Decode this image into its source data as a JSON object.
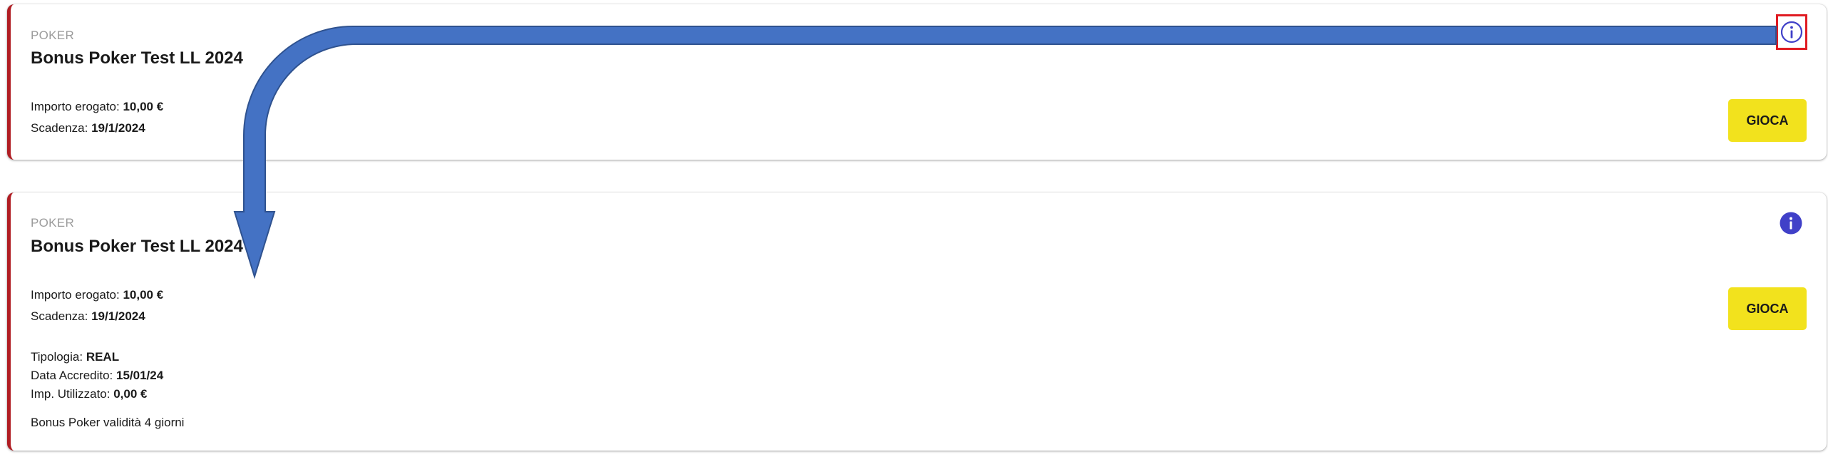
{
  "cards": [
    {
      "category": "POKER",
      "title": "Bonus Poker Test LL 2024",
      "amount_label": "Importo erogato: ",
      "amount_value": "10,00 €",
      "expiry_label": "Scadenza: ",
      "expiry_value": "19/1/2024",
      "play_label": "GIOCA",
      "info_state": "outlined"
    },
    {
      "category": "POKER",
      "title": "Bonus Poker Test LL 2024",
      "amount_label": "Importo erogato: ",
      "amount_value": "10,00 €",
      "expiry_label": "Scadenza: ",
      "expiry_value": "19/1/2024",
      "type_label": "Tipologia: ",
      "type_value": "REAL",
      "credit_date_label": "Data Accredito: ",
      "credit_date_value": "15/01/24",
      "used_label": "Imp. Utilizzato: ",
      "used_value": "0,00 €",
      "note": "Bonus Poker validità 4 giorni",
      "play_label": "GIOCA",
      "info_state": "filled"
    }
  ],
  "colors": {
    "accent_bar": "#b01c22",
    "play_button": "#f2e21d",
    "info_icon": "#4040c8",
    "highlight_box": "#e01b22",
    "arrow_fill": "#4472c4",
    "arrow_stroke": "#2f528f"
  },
  "icons": {
    "info_outlined": "info-outline-icon",
    "info_filled": "info-filled-icon",
    "callout": "curved-arrow-icon"
  }
}
